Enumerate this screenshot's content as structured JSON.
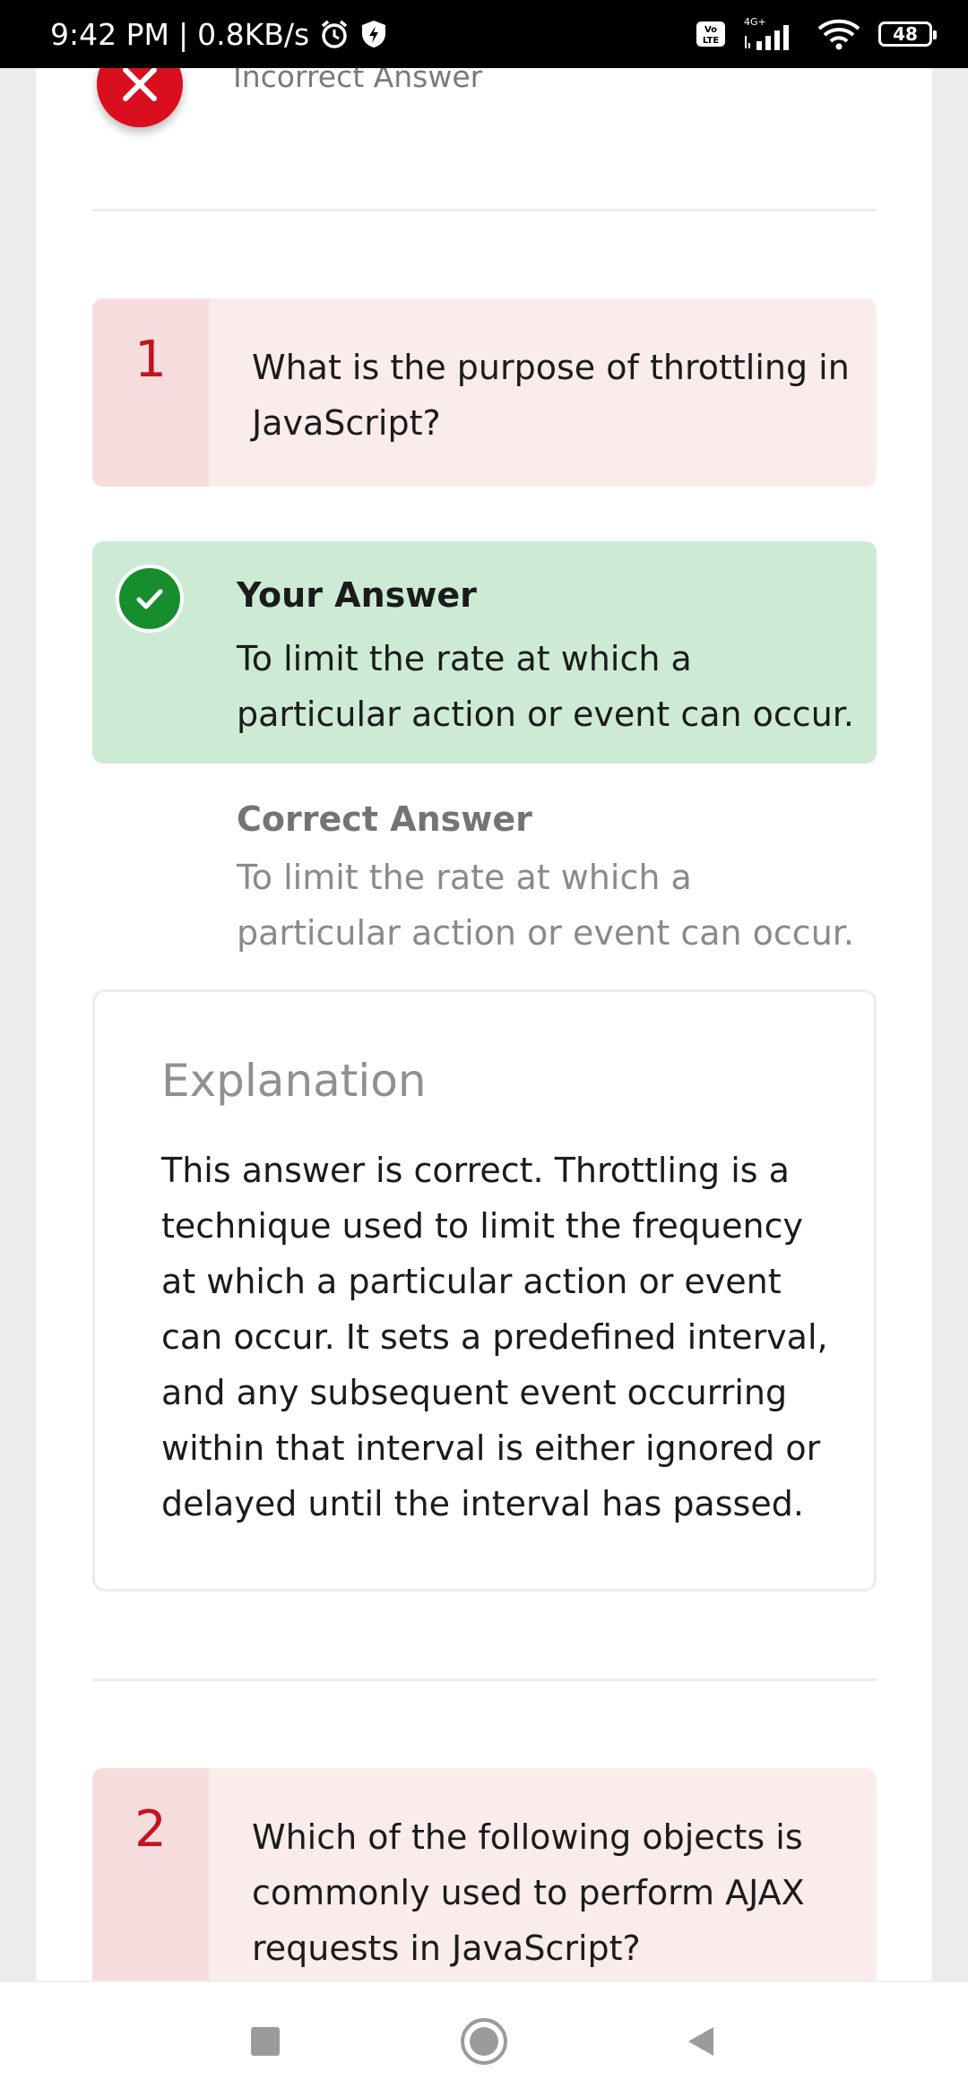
{
  "status_bar": {
    "time": "9:42 PM",
    "speed": "0.8KB/s",
    "network": "4G+",
    "volte": "Vo LTE",
    "battery": "48"
  },
  "header": {
    "result_text": "Incorrect Answer"
  },
  "questions": [
    {
      "number": "1",
      "text": "What is the purpose of throttling in JavaScript?",
      "your_answer_label": "Your Answer",
      "your_answer": "To limit the rate at which a particular action or event can occur.",
      "correct_answer_label": "Correct Answer",
      "correct_answer": "To limit the rate at which a particular action or event can occur.",
      "explanation_title": "Explanation",
      "explanation": "This answer is correct. Throttling is a technique used to limit the frequency at which a particular action or event can occur. It sets a predefined interval, and any subsequent event occurring within that interval is either ignored or delayed until the interval has passed."
    },
    {
      "number": "2",
      "text": "Which of the following objects is commonly used to perform AJAX requests in JavaScript?"
    }
  ],
  "colors": {
    "incorrect": "#d90f1f",
    "correct": "#168e2e",
    "answer_bg": "#cdebd4",
    "question_bg": "#faeceb"
  }
}
